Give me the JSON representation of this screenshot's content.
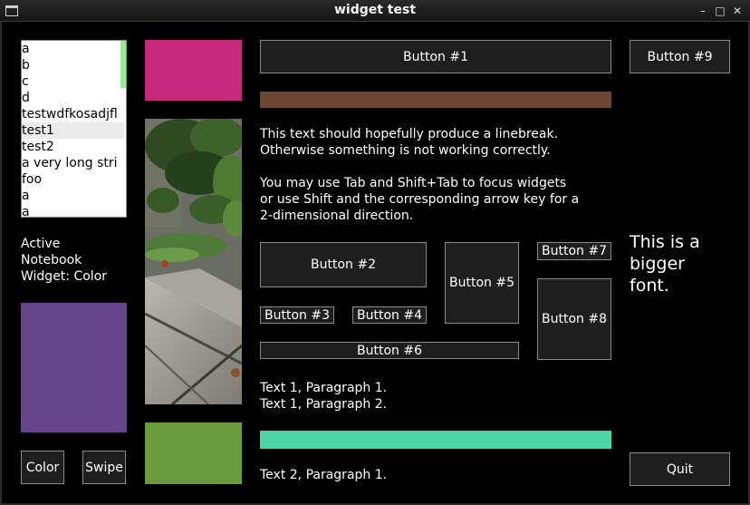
{
  "window": {
    "title": "widget test"
  },
  "list": {
    "items": [
      "a",
      "b",
      "c",
      "d",
      "testwdfkosadjfl",
      "test1",
      "test2",
      "a very long stri",
      "foo",
      "a",
      "a"
    ],
    "selected_index": 5
  },
  "status": {
    "line1": "Active",
    "line2": "Notebook",
    "line3": "Widget: Color"
  },
  "buttons": {
    "color": "Color",
    "swipe": "Swipe",
    "b1": "Button #1",
    "b2": "Button #2",
    "b3": "Button #3",
    "b4": "Button #4",
    "b5": "Button #5",
    "b6": "Button #6",
    "b7": "Button #7",
    "b8": "Button #8",
    "b9": "Button #9",
    "quit": "Quit"
  },
  "text": {
    "para1_line1": "This text should hopefully produce a linebreak.",
    "para1_line2": "Otherwise something is not working correctly.",
    "para2_line1": "You may use Tab and Shift+Tab to focus widgets",
    "para2_line2": "or use Shift and the corresponding arrow key for a",
    "para2_line3": "2-dimensional direction.",
    "t1p1": "Text 1, Paragraph 1.",
    "t1p2": "Text 1, Paragraph 2.",
    "t2p1": "Text 2, Paragraph 1.",
    "big_line1": "This is a",
    "big_line2": "bigger",
    "big_line3": "font."
  },
  "colors": {
    "color_preview": "#64448a",
    "swatch_magenta": "#c72a7c",
    "swatch_green": "#6a9a3e",
    "bar_brown": "#6e4634",
    "bar_teal": "#4fd6a8"
  }
}
